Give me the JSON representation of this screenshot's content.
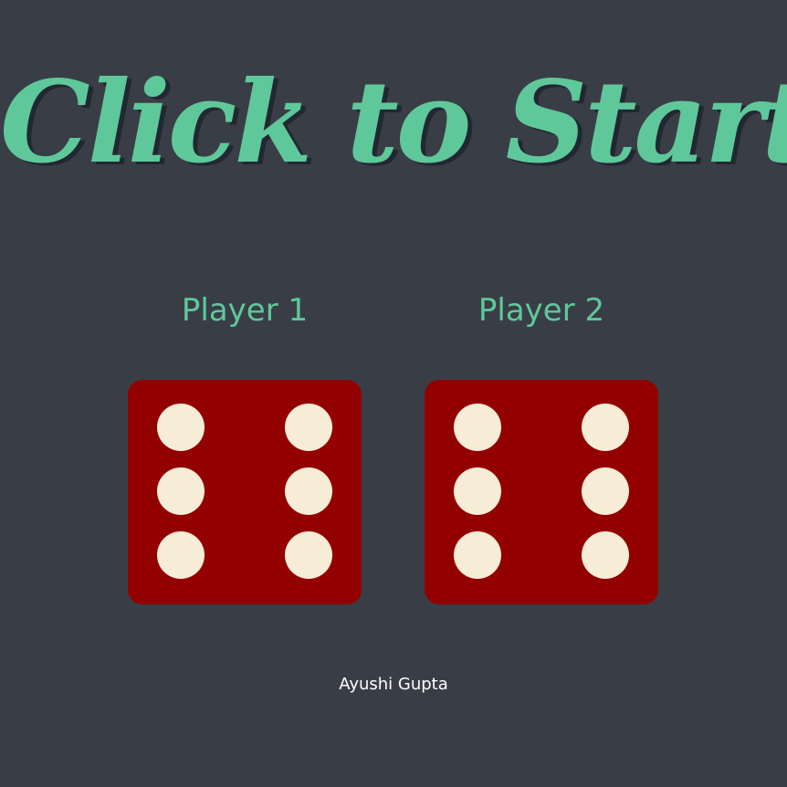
{
  "title": "Click to Start",
  "players": [
    {
      "label": "Player 1",
      "die_value": 6
    },
    {
      "label": "Player 2",
      "die_value": 6
    }
  ],
  "credit": "Ayushi Gupta",
  "colors": {
    "background": "#393e46",
    "accent": "#5fc89b",
    "die": "#930000",
    "pip": "#f7ecd5"
  }
}
